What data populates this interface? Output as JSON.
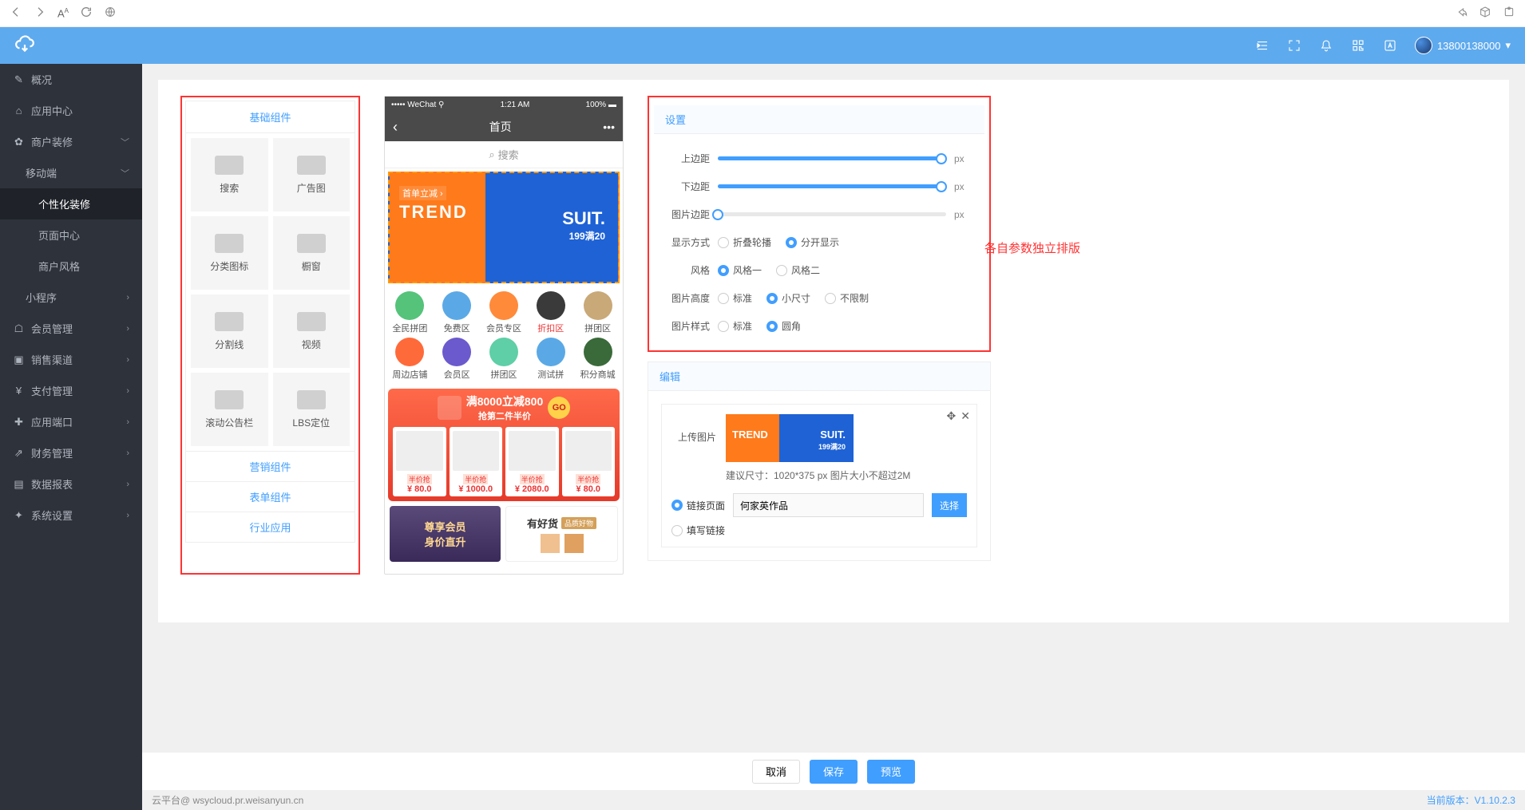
{
  "browser": {},
  "header": {
    "phone": "13800138000"
  },
  "sidebar": {
    "items": [
      {
        "label": "概况",
        "icon": "pencil-icon",
        "chev": ""
      },
      {
        "label": "应用中心",
        "icon": "home-icon",
        "chev": ""
      },
      {
        "label": "商户装修",
        "icon": "gear-icon",
        "chev": "﹀"
      },
      {
        "label": "移动端",
        "sub": 1,
        "chev": "﹀"
      },
      {
        "label": "个性化装修",
        "sub": 2,
        "active": true
      },
      {
        "label": "页面中心",
        "sub": 2
      },
      {
        "label": "商户风格",
        "sub": 2
      },
      {
        "label": "小程序",
        "sub": 1,
        "chev": "›"
      },
      {
        "label": "会员管理",
        "icon": "users-icon",
        "chev": "›"
      },
      {
        "label": "销售渠道",
        "icon": "video-icon",
        "chev": "›"
      },
      {
        "label": "支付管理",
        "icon": "yen-icon",
        "chev": "›"
      },
      {
        "label": "应用端口",
        "icon": "puzzle-icon",
        "chev": "›"
      },
      {
        "label": "财务管理",
        "icon": "chart-icon",
        "chev": "›"
      },
      {
        "label": "数据报表",
        "icon": "list-icon",
        "chev": "›"
      },
      {
        "label": "系统设置",
        "icon": "wrench-icon",
        "chev": "›"
      }
    ]
  },
  "palette": {
    "header": "基础组件",
    "items": [
      {
        "label": "搜索"
      },
      {
        "label": "广告图"
      },
      {
        "label": "分类图标"
      },
      {
        "label": "橱窗"
      },
      {
        "label": "分割线"
      },
      {
        "label": "视频"
      },
      {
        "label": "滚动公告栏"
      },
      {
        "label": "LBS定位"
      }
    ],
    "footer": [
      "营销组件",
      "表单组件",
      "行业应用"
    ]
  },
  "phone": {
    "status_left": "••••• WeChat ⚲",
    "status_time": "1:21 AM",
    "status_right": "100% ▬",
    "nav_title": "首页",
    "search_ph": "搜索",
    "banner": {
      "sub": "首单立减 ›",
      "trend": "TREND",
      "suit": "SUIT.",
      "price": "199满20"
    },
    "icons": [
      {
        "label": "全民拼团",
        "color": "#55c37a"
      },
      {
        "label": "免费区",
        "color": "#5aa9e6"
      },
      {
        "label": "会员专区",
        "color": "#ff8a3a"
      },
      {
        "label": "折扣区",
        "color": "#3a3a3a",
        "red": true
      },
      {
        "label": "拼团区",
        "color": "#c9a978"
      },
      {
        "label": "周边店铺",
        "color": "#ff6a3a"
      },
      {
        "label": "会员区",
        "color": "#6a5acd"
      },
      {
        "label": "拼团区",
        "color": "#5ecfa6"
      },
      {
        "label": "测试拼",
        "color": "#5aa9e6"
      },
      {
        "label": "积分商城",
        "color": "#3a6a3a"
      }
    ],
    "promo": {
      "title": "满8000立减800",
      "sub": "抢第二件半价",
      "go": "GO",
      "items": [
        {
          "tag": "半价抢",
          "price": "¥ 80.0"
        },
        {
          "tag": "半价抢",
          "price": "¥ 1000.0"
        },
        {
          "tag": "半价抢",
          "price": "¥ 2080.0"
        },
        {
          "tag": "半价抢",
          "price": "¥ 80.0"
        }
      ]
    },
    "bottom": {
      "a1": "尊享会员",
      "a2": "身价直升",
      "b1": "有好货",
      "b2": "品质好物"
    }
  },
  "settings": {
    "title": "设置",
    "rows": {
      "top_margin": "上边距",
      "bottom_margin": "下边距",
      "img_margin": "图片边距",
      "display_mode": "显示方式",
      "style": "风格",
      "img_height": "图片高度",
      "img_style": "图片样式",
      "unit": "px"
    },
    "display_options": [
      "折叠轮播",
      "分开显示"
    ],
    "style_options": [
      "风格一",
      "风格二"
    ],
    "height_options": [
      "标准",
      "小尺寸",
      "不限制"
    ],
    "imgstyle_options": [
      "标准",
      "圆角"
    ]
  },
  "editor": {
    "title": "编辑",
    "upload_label": "上传图片",
    "thumb": {
      "t1": "TREND",
      "t2": "SUIT.",
      "t3": "199满20"
    },
    "hint": "建议尺寸：1020*375 px 图片大小不超过2M",
    "link_label": "链接页面",
    "link_value": "何家英作品",
    "select_btn": "选择",
    "fill_label": "填写链接"
  },
  "annotation": "各自参数独立排版",
  "actions": {
    "cancel": "取消",
    "save": "保存",
    "preview": "预览"
  },
  "status": {
    "left": "云平台@ wsycloud.pr.weisanyun.cn",
    "right": "当前版本：V1.10.2.3"
  }
}
